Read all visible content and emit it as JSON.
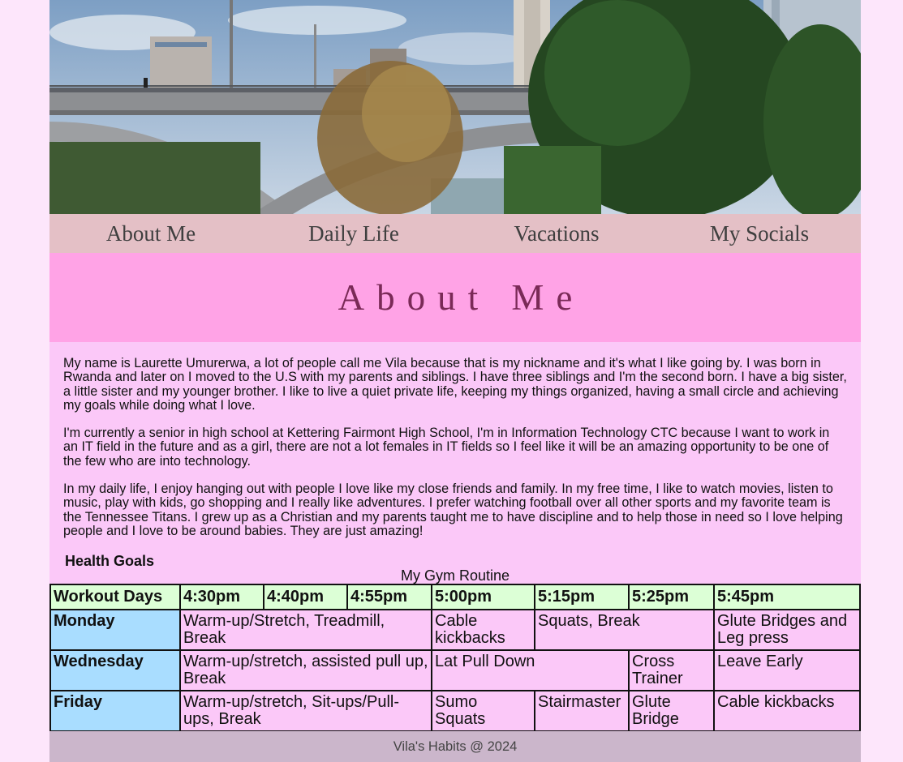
{
  "nav": {
    "items": [
      {
        "label": "About Me"
      },
      {
        "label": "Daily Life"
      },
      {
        "label": "Vacations"
      },
      {
        "label": "My Socials"
      }
    ]
  },
  "main": {
    "title": "About Me",
    "paragraphs": [
      "My name is Laurette Umurerwa, a lot of people call me Vila because that is my nickname and it's what I like going by. I was born in Rwanda and later on I moved to the U.S with my parents and siblings. I have three siblings and I'm the second born. I have a big sister, a little sister and my younger brother. I like to live a quiet private life, keeping my things organized, having a small circle and achieving my goals while doing what I love.",
      "I'm currently a senior in high school at Kettering Fairmont High School, I'm in Information Technology CTC because I want to work in an IT field in the future and as a girl, there are not a lot females in IT fields so I feel like it will be an amazing opportunity to be one of the few who are into technology.",
      "In my daily life, I enjoy hanging out with people I love like my close friends and family. In my free time, I like to watch movies, listen to music, play with kids, go shopping and I really like adventures. I prefer watching football over all other sports and my favorite team is the Tennessee Titans. I grew up as a Christian and my parents taught me to have discipline and to help those in need so I love helping people and I love to be around babies. They are just amazing!"
    ],
    "health_heading": "Health Goals",
    "table": {
      "caption": "My Gym Routine",
      "headers": [
        "Workout Days",
        "4:30pm",
        "4:40pm",
        "4:55pm",
        "5:00pm",
        "5:15pm",
        "5:25pm",
        "5:45pm"
      ],
      "rows": [
        {
          "day": "Monday",
          "cells": [
            "Warm-up/Stretch, Treadmill, Break",
            "Cable kickbacks",
            "Squats, Break",
            "Glute Bridges and Leg press"
          ]
        },
        {
          "day": "Wednesday",
          "cells": [
            "Warm-up/stretch, assisted pull up, Break",
            "Lat Pull Down",
            "Cross Trainer",
            "Leave Early"
          ]
        },
        {
          "day": "Friday",
          "cells": [
            "Warm-up/stretch, Sit-ups/Pull-ups, Break",
            "Sumo Squats",
            "Stairmaster",
            "Glute Bridge",
            "Cable kickbacks"
          ]
        }
      ]
    }
  },
  "footer": {
    "text": "Vila's Habits @ 2024"
  },
  "colors": {
    "page_bg": "#fbc8f8",
    "nav_bg": "#e4c0c6",
    "title_band": "#ffa3e6",
    "title_text": "#7a2a57",
    "table_header_bg": "#dcffd6",
    "table_day_bg": "#a9ddff",
    "footer_bg": "#cbb6cb"
  }
}
